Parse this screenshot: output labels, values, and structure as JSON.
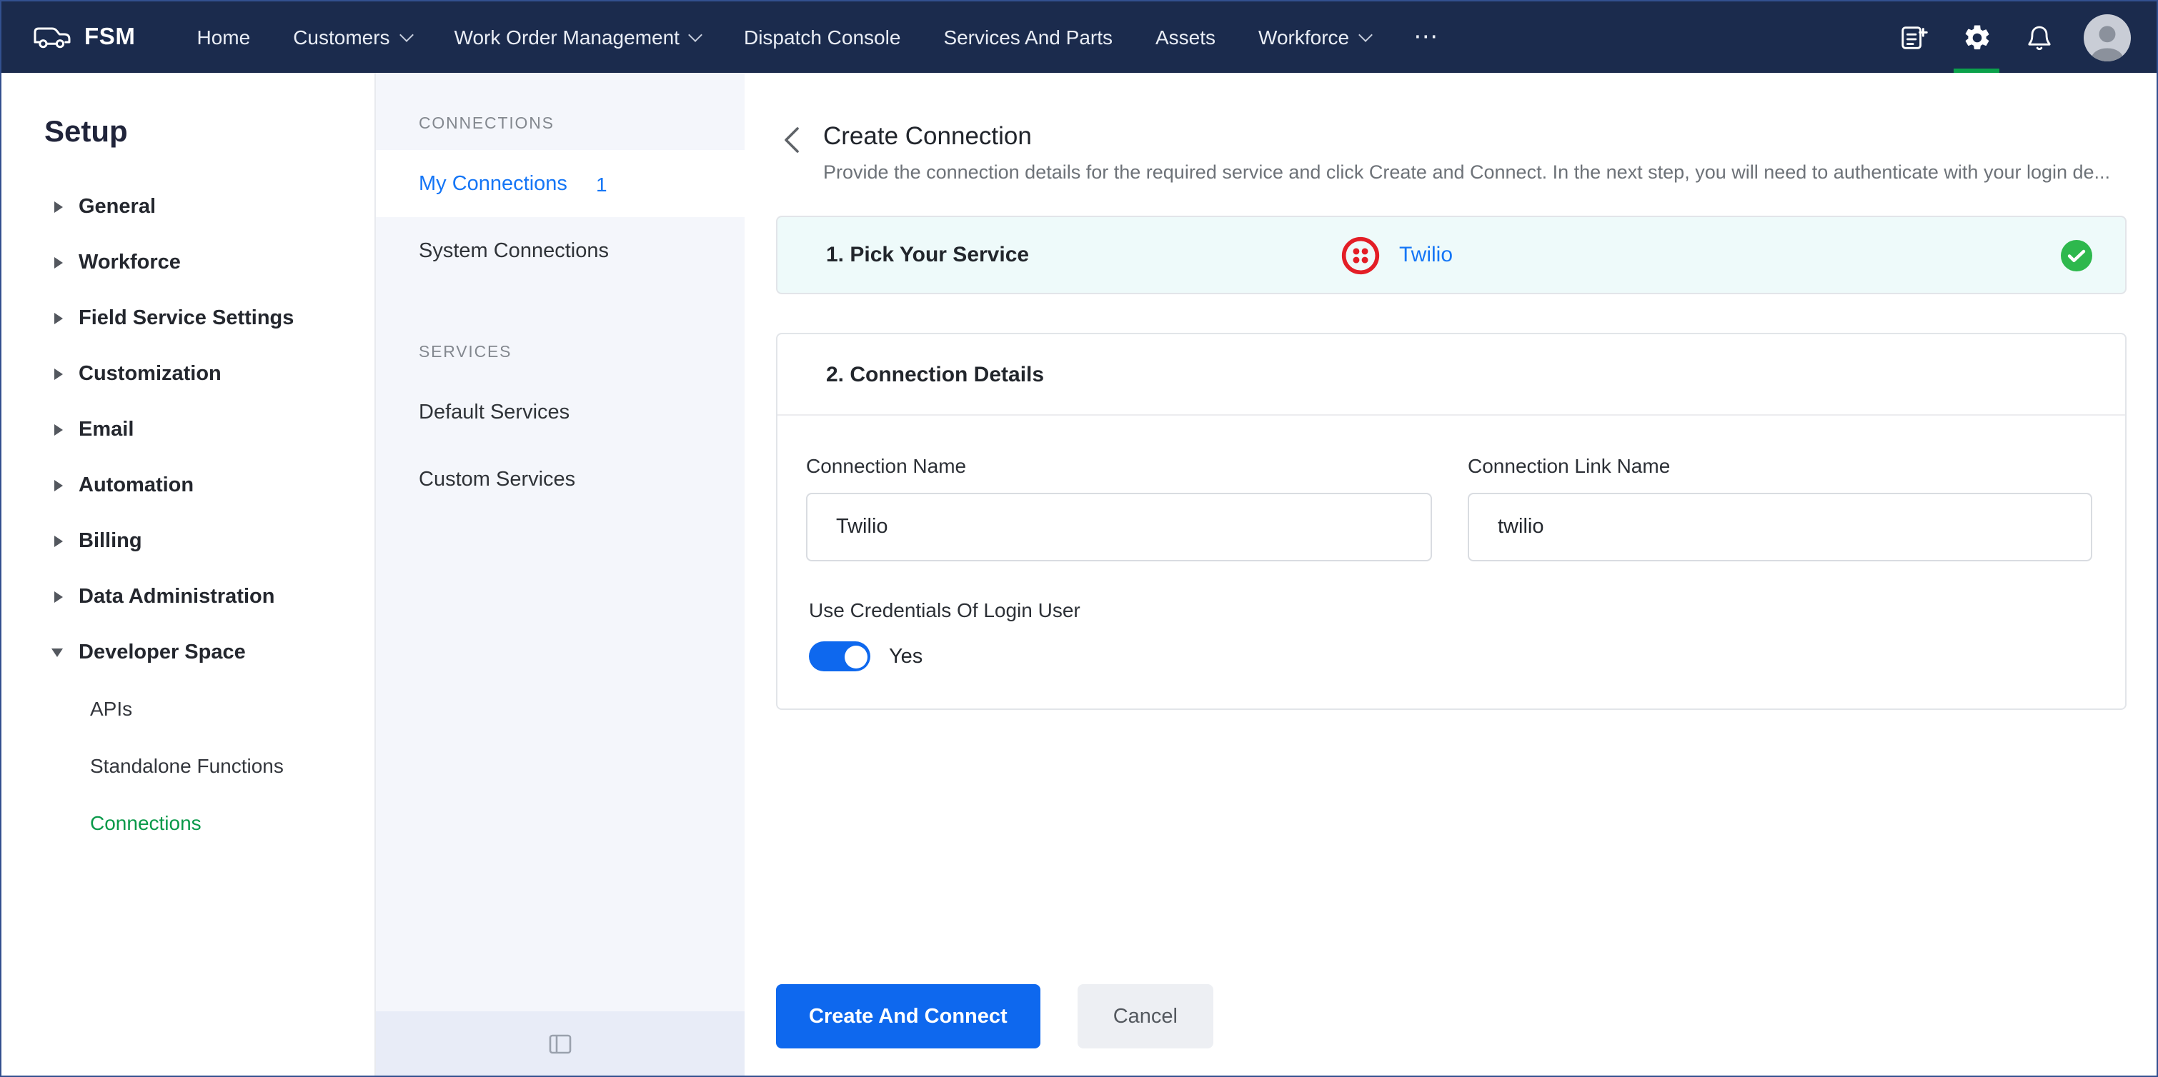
{
  "navbar": {
    "brand": "FSM",
    "items": [
      {
        "label": "Home",
        "dropdown": false
      },
      {
        "label": "Customers",
        "dropdown": true
      },
      {
        "label": "Work Order Management",
        "dropdown": true
      },
      {
        "label": "Dispatch Console",
        "dropdown": false
      },
      {
        "label": "Services And Parts",
        "dropdown": false
      },
      {
        "label": "Assets",
        "dropdown": false
      },
      {
        "label": "Workforce",
        "dropdown": true
      }
    ],
    "more_label": "⋯",
    "right_icons": [
      "compose-icon",
      "settings-gear-icon",
      "notifications-bell-icon",
      "user-avatar"
    ],
    "active_icon": "settings-gear-icon",
    "colors": {
      "background": "#1b2b4d",
      "active_underline": "#0ba14b"
    }
  },
  "setup_sidebar": {
    "title": "Setup",
    "items": [
      {
        "label": "General",
        "expanded": false
      },
      {
        "label": "Workforce",
        "expanded": false
      },
      {
        "label": "Field Service Settings",
        "expanded": false
      },
      {
        "label": "Customization",
        "expanded": false
      },
      {
        "label": "Email",
        "expanded": false
      },
      {
        "label": "Automation",
        "expanded": false
      },
      {
        "label": "Billing",
        "expanded": false
      },
      {
        "label": "Data Administration",
        "expanded": false
      },
      {
        "label": "Developer Space",
        "expanded": true
      }
    ],
    "sub_items": [
      {
        "label": "APIs",
        "active": false
      },
      {
        "label": "Standalone Functions",
        "active": false
      },
      {
        "label": "Connections",
        "active": true
      }
    ],
    "active_color": "#089949"
  },
  "connections_panel": {
    "sections": [
      {
        "header": "CONNECTIONS",
        "items": [
          {
            "label": "My Connections",
            "count": "1",
            "active": true
          },
          {
            "label": "System Connections",
            "active": false
          }
        ]
      },
      {
        "header": "SERVICES",
        "items": [
          {
            "label": "Default Services",
            "active": false
          },
          {
            "label": "Custom Services",
            "active": false
          }
        ]
      }
    ]
  },
  "main": {
    "title": "Create Connection",
    "subtitle": "Provide the connection details for the required service and click Create and Connect. In the next step, you will need to authenticate with your login de...",
    "step1": {
      "title": "1. Pick Your Service",
      "service_name": "Twilio",
      "completed": true
    },
    "step2": {
      "title": "2. Connection Details",
      "fields": [
        {
          "label": "Connection Name",
          "value": "Twilio"
        },
        {
          "label": "Connection Link Name",
          "value": "twilio"
        }
      ],
      "toggle": {
        "label": "Use Credentials Of Login User",
        "state_label": "Yes",
        "on": true
      }
    },
    "actions": {
      "primary": "Create And Connect",
      "secondary": "Cancel"
    },
    "colors": {
      "link_blue": "#1576f6",
      "primary_button": "#0e68ee",
      "success_green": "#2eb84d",
      "twilio_red": "#e31e26",
      "step1_background": "#eefafa"
    }
  }
}
